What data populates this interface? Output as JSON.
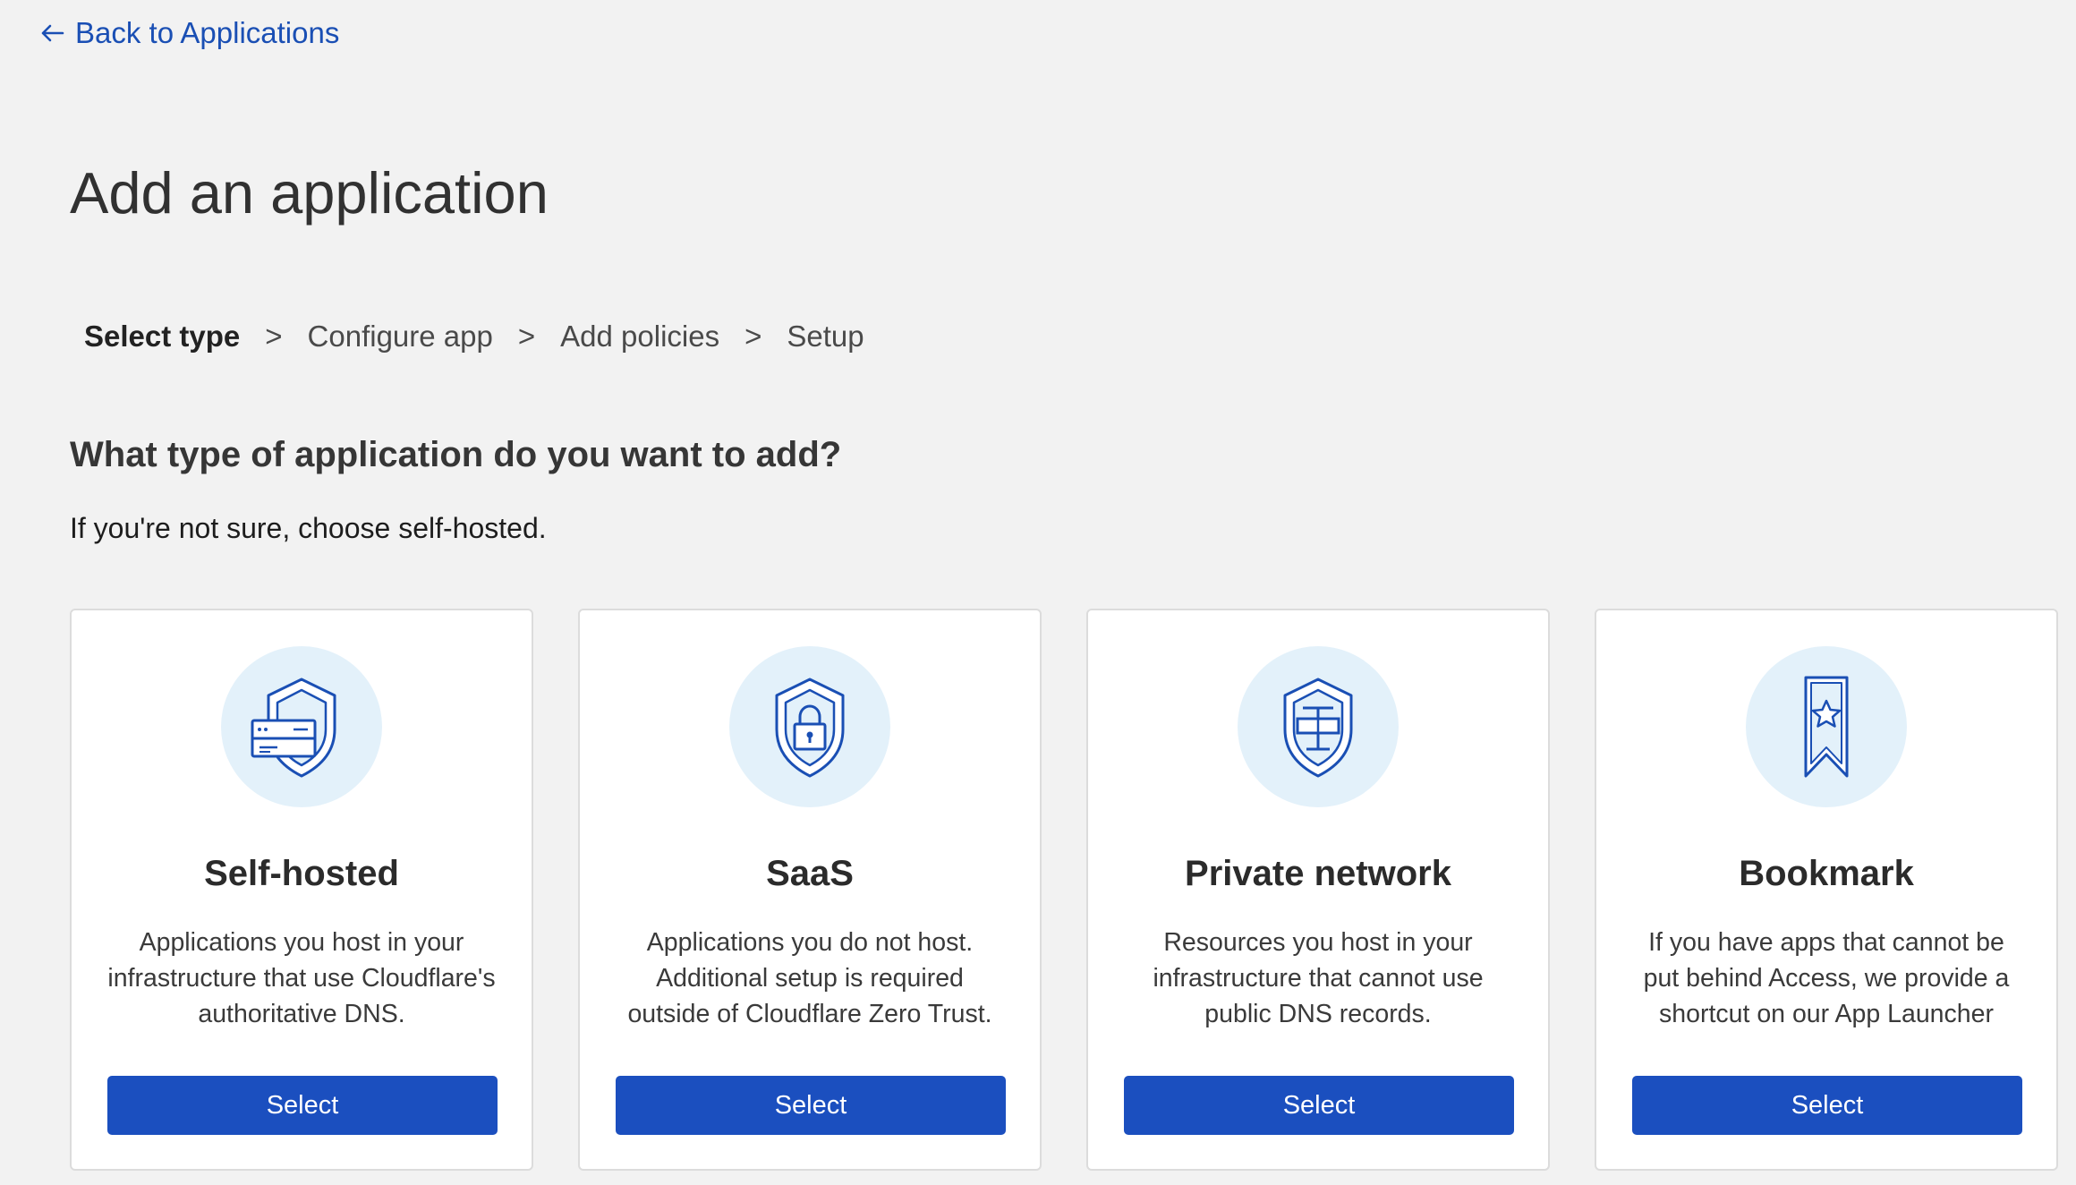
{
  "nav": {
    "back_label": "Back to Applications"
  },
  "page": {
    "title": "Add an application"
  },
  "steps": [
    {
      "label": "Select type",
      "active": true
    },
    {
      "label": "Configure app",
      "active": false
    },
    {
      "label": "Add policies",
      "active": false
    },
    {
      "label": "Setup",
      "active": false
    }
  ],
  "step_separator": ">",
  "question": "What type of application do you want to add?",
  "hint": "If you're not sure, choose self-hosted.",
  "cards": [
    {
      "icon": "shield-server-icon",
      "title": "Self-hosted",
      "description": "Applications you host in your infrastructure that use Cloudflare's authoritative DNS.",
      "button": "Select"
    },
    {
      "icon": "shield-lock-icon",
      "title": "SaaS",
      "description": "Applications you do not host. Additional setup is required outside of Cloudflare Zero Trust.",
      "button": "Select"
    },
    {
      "icon": "shield-network-icon",
      "title": "Private network",
      "description": "Resources you host in your infrastructure that cannot use public DNS records.",
      "button": "Select"
    },
    {
      "icon": "bookmark-star-icon",
      "title": "Bookmark",
      "description": "If you have apps that cannot be put behind Access, we provide a shortcut on our App Launcher",
      "button": "Select"
    }
  ],
  "colors": {
    "accent": "#1b4fbf",
    "link": "#1a4fb4",
    "icon_bg": "#e3f1fa",
    "icon_stroke": "#1a4fb4",
    "background": "#f2f2f2"
  }
}
